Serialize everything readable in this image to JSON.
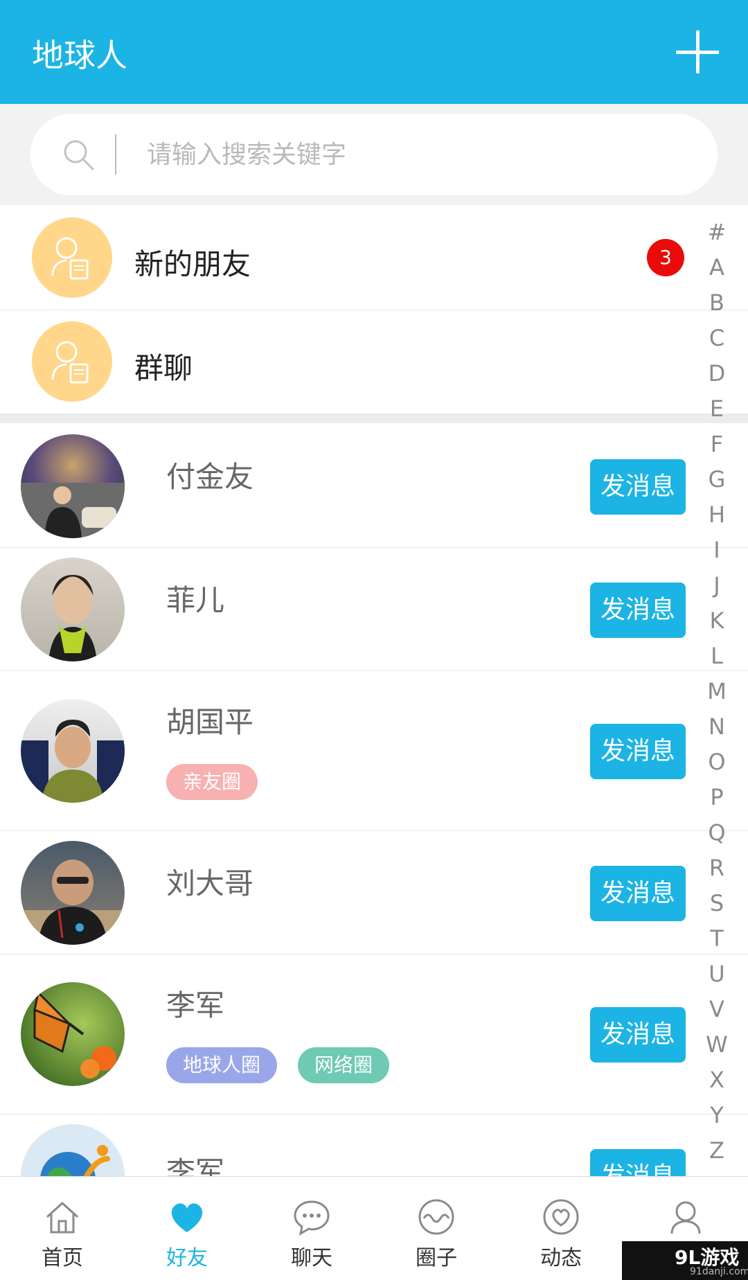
{
  "header": {
    "title": "地球人",
    "add_icon": "plus-icon"
  },
  "search": {
    "placeholder": "请输入搜索关键字"
  },
  "top_items": [
    {
      "label": "新的朋友",
      "badge": "3",
      "icon": "contact-card-icon"
    },
    {
      "label": "群聊",
      "icon": "contact-card-icon"
    }
  ],
  "friends": [
    {
      "name": "付金友",
      "tags": [],
      "button": "发消息"
    },
    {
      "name": "菲儿",
      "tags": [],
      "button": "发消息"
    },
    {
      "name": "胡国平",
      "tags": [
        "亲友圈"
      ],
      "button": "发消息"
    },
    {
      "name": "刘大哥",
      "tags": [],
      "button": "发消息"
    },
    {
      "name": "李军",
      "tags": [
        "地球人圈",
        "网络圈"
      ],
      "button": "发消息"
    },
    {
      "name": "李军",
      "tags": [],
      "button": "发消息"
    }
  ],
  "alphabet": [
    "#",
    "A",
    "B",
    "C",
    "D",
    "E",
    "F",
    "G",
    "H",
    "I",
    "J",
    "K",
    "L",
    "M",
    "N",
    "O",
    "P",
    "Q",
    "R",
    "S",
    "T",
    "U",
    "V",
    "W",
    "X",
    "Y",
    "Z"
  ],
  "nav": [
    {
      "label": "首页",
      "icon": "home-icon"
    },
    {
      "label": "好友",
      "icon": "heart-icon",
      "active": true
    },
    {
      "label": "聊天",
      "icon": "chat-bubble-icon"
    },
    {
      "label": "圈子",
      "icon": "wave-circle-icon"
    },
    {
      "label": "动态",
      "icon": "heart-circle-icon"
    },
    {
      "label": "",
      "icon": "user-icon"
    }
  ],
  "watermark": {
    "brand": "9L游戏",
    "url": "91danji.com"
  },
  "colors": {
    "accent": "#1bb4e4",
    "badge": "#ea0a0a",
    "tag_pink": "#f7b1b1",
    "tag_purple": "#9aa6ea",
    "tag_teal": "#6ecab3"
  }
}
